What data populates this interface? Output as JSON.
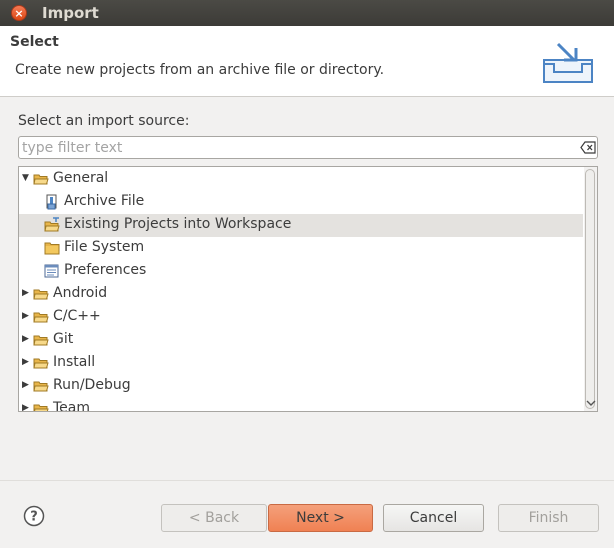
{
  "window": {
    "title": "Import",
    "close_glyph": "×"
  },
  "header": {
    "title": "Select",
    "description": "Create new projects from an archive file or directory."
  },
  "source": {
    "label": "Select an import source:",
    "filter_placeholder": "type filter text",
    "filter_value": ""
  },
  "tree": {
    "items": [
      {
        "label": "General",
        "level": 0,
        "expanded": true,
        "icon": "folder-icon"
      },
      {
        "label": "Archive File",
        "level": 1,
        "icon": "archive-file-icon"
      },
      {
        "label": "Existing Projects into Workspace",
        "level": 1,
        "icon": "import-projects-icon",
        "selected": true
      },
      {
        "label": "File System",
        "level": 1,
        "icon": "folder-icon"
      },
      {
        "label": "Preferences",
        "level": 1,
        "icon": "preferences-icon"
      },
      {
        "label": "Android",
        "level": 0,
        "expanded": false,
        "icon": "folder-icon"
      },
      {
        "label": "C/C++",
        "level": 0,
        "expanded": false,
        "icon": "folder-icon"
      },
      {
        "label": "Git",
        "level": 0,
        "expanded": false,
        "icon": "folder-icon"
      },
      {
        "label": "Install",
        "level": 0,
        "expanded": false,
        "icon": "folder-icon"
      },
      {
        "label": "Run/Debug",
        "level": 0,
        "expanded": false,
        "icon": "folder-icon"
      },
      {
        "label": "Team",
        "level": 0,
        "expanded": false,
        "icon": "folder-icon"
      }
    ]
  },
  "footer": {
    "help_glyph": "?",
    "back_label": "< Back",
    "next_label": "Next >",
    "cancel_label": "Cancel",
    "finish_label": "Finish"
  },
  "colors": {
    "accent_button": "#f08153",
    "selection": "#e4e2df",
    "titlebar": "#3c3b37",
    "folder": "#e8b54a"
  }
}
